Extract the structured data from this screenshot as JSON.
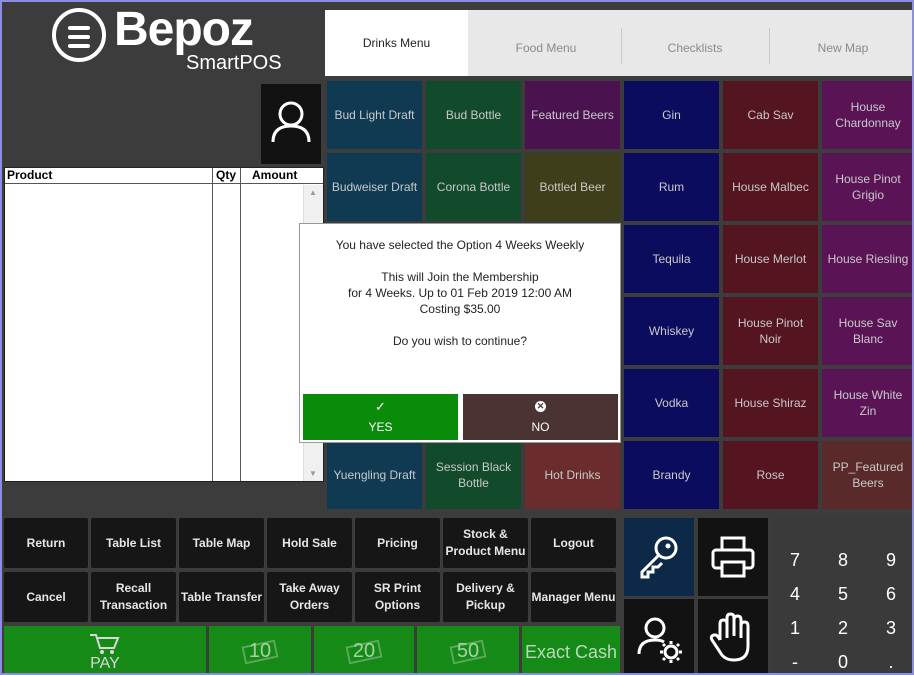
{
  "brand": {
    "name": "Bepoz",
    "sub": "SmartPOS"
  },
  "tabs": [
    {
      "label": "Drinks Menu",
      "active": true
    },
    {
      "label": "Food Menu",
      "active": false
    },
    {
      "label": "Checklists",
      "active": false
    },
    {
      "label": "New Map",
      "active": false
    }
  ],
  "product_list": {
    "headers": {
      "product": "Product",
      "qty": "Qty",
      "amount": "Amount"
    },
    "rows": []
  },
  "items": [
    [
      "Bud Light Draft",
      "Bud Bottle",
      "Featured Beers",
      "Gin",
      "Cab Sav",
      "House Chardonnay"
    ],
    [
      "Budweiser Draft",
      "Corona Bottle",
      "Bottled Beer",
      "Rum",
      "House Malbec",
      "House Pinot Grigio"
    ],
    [
      "",
      "",
      "",
      "Tequila",
      "House Merlot",
      "House Riesling"
    ],
    [
      "",
      "",
      "",
      "Whiskey",
      "House Pinot Noir",
      "House Sav Blanc"
    ],
    [
      "",
      "",
      "",
      "Vodka",
      "House Shiraz",
      "House White Zin"
    ],
    [
      "Yuengling Draft",
      "Session Black Bottle",
      "Hot Drinks",
      "Brandy",
      "Rose",
      "PP_Featured Beers"
    ]
  ],
  "item_colors": [
    "#103a52",
    "#124a2c",
    "#4a1350",
    "#0c0c5e",
    "#541420",
    "#5a1456"
  ],
  "hot_drinks_color": "#6a2c2c",
  "bottled_beer_color": "#3e3e1a",
  "pp_featured_color": "#5a2a2a",
  "functions": {
    "row1": [
      "Return",
      "Table List",
      "Table Map",
      "Hold Sale",
      "Pricing",
      "Stock & Product Menu",
      "Logout"
    ],
    "row2": [
      "Cancel",
      "Recall Transaction",
      "Table Transfer",
      "Take Away Orders",
      "SR Print Options",
      "Delivery & Pickup",
      "Manager Menu"
    ]
  },
  "pay_row": {
    "pay": "PAY",
    "ten": "10",
    "twenty": "20",
    "fifty": "50",
    "exact": "Exact Cash"
  },
  "numpad": [
    "7",
    "8",
    "9",
    "4",
    "5",
    "6",
    "1",
    "2",
    "3",
    "-",
    "0",
    "."
  ],
  "dialog": {
    "line1": "You have selected the Option 4 Weeks Weekly",
    "line2": "This will Join the Membership",
    "line3": "for 4 Weeks. Up to 01 Feb 2019 12:00 AM",
    "line4": "Costing $35.00",
    "line5": "Do you wish to continue?",
    "yes": "YES",
    "no": "NO",
    "yes_color": "#0a8c0a",
    "no_color": "#4a3332"
  },
  "icons": {
    "menu": "hamburger-icon",
    "user": "user-icon",
    "key": "key-icon",
    "printer": "printer-icon",
    "user_settings": "user-settings-icon",
    "hand": "hand-icon",
    "cart": "cart-icon",
    "cash": "banknote-icon",
    "check": "check-icon",
    "close": "close-circle-icon"
  }
}
